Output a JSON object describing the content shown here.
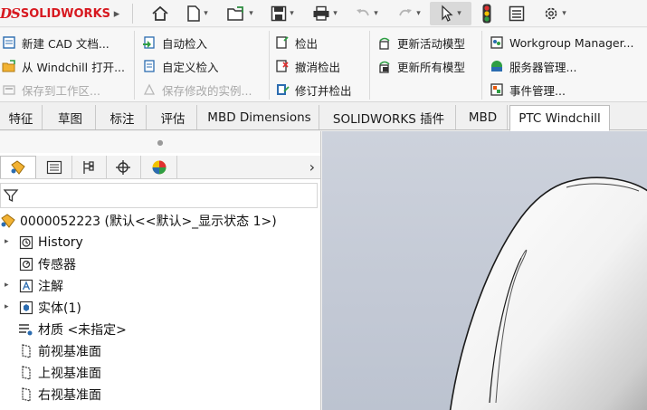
{
  "app": {
    "logo_mark": "DS",
    "logo_text": "SOLIDWORKS"
  },
  "quick_access": [
    "home-icon",
    "new-document-icon",
    "open-icon",
    "save-icon",
    "print-icon",
    "undo-icon",
    "redo-icon",
    "select-icon",
    "traffic-light-icon",
    "options-list-icon",
    "settings-gear-icon"
  ],
  "ribbon": {
    "group1": {
      "new_cad": "新建 CAD 文档...",
      "open_windchill": "从 Windchill 打开...",
      "save_workspace": "保存到工作区..."
    },
    "group2": {
      "auto_checkin": "自动检入",
      "custom_checkin": "自定义检入",
      "save_modified": "保存修改的实例..."
    },
    "group3": {
      "checkout": "检出",
      "undo_checkout": "撤消检出",
      "revise_checkout": "修订并检出"
    },
    "group4": {
      "update_active": "更新活动模型",
      "update_all": "更新所有模型"
    },
    "group5": {
      "workgroup_manager": "Workgroup Manager...",
      "server_manager": "服务器管理...",
      "event_manager": "事件管理..."
    }
  },
  "tabs": [
    {
      "label": "特征"
    },
    {
      "label": "草图"
    },
    {
      "label": "标注"
    },
    {
      "label": "评估"
    },
    {
      "label": "MBD Dimensions"
    },
    {
      "label": "SOLIDWORKS 插件"
    },
    {
      "label": "MBD"
    },
    {
      "label": "PTC Windchill"
    }
  ],
  "active_tab": "PTC Windchill",
  "feature_manager": {
    "tabs": [
      "feature-manager-icon",
      "property-manager-icon",
      "configuration-manager-icon",
      "dimxpert-icon",
      "display-manager-icon"
    ],
    "more_arrow": "›",
    "tree": {
      "root": "0000052223  (默认<<默认>_显示状态 1>)",
      "items": [
        {
          "label": "History",
          "expandable": true
        },
        {
          "label": "传感器",
          "expandable": false
        },
        {
          "label": "注解",
          "expandable": true
        },
        {
          "label": "实体(1)",
          "expandable": true
        },
        {
          "label": "材质 <未指定>",
          "expandable": false
        },
        {
          "label": "前视基准面",
          "expandable": false
        },
        {
          "label": "上视基准面",
          "expandable": false
        },
        {
          "label": "右视基准面",
          "expandable": false
        }
      ]
    }
  },
  "colors": {
    "brand_red": "#d71920",
    "viewport_bg": "#c6ccd7",
    "accent_blue": "#2b6cb0"
  }
}
